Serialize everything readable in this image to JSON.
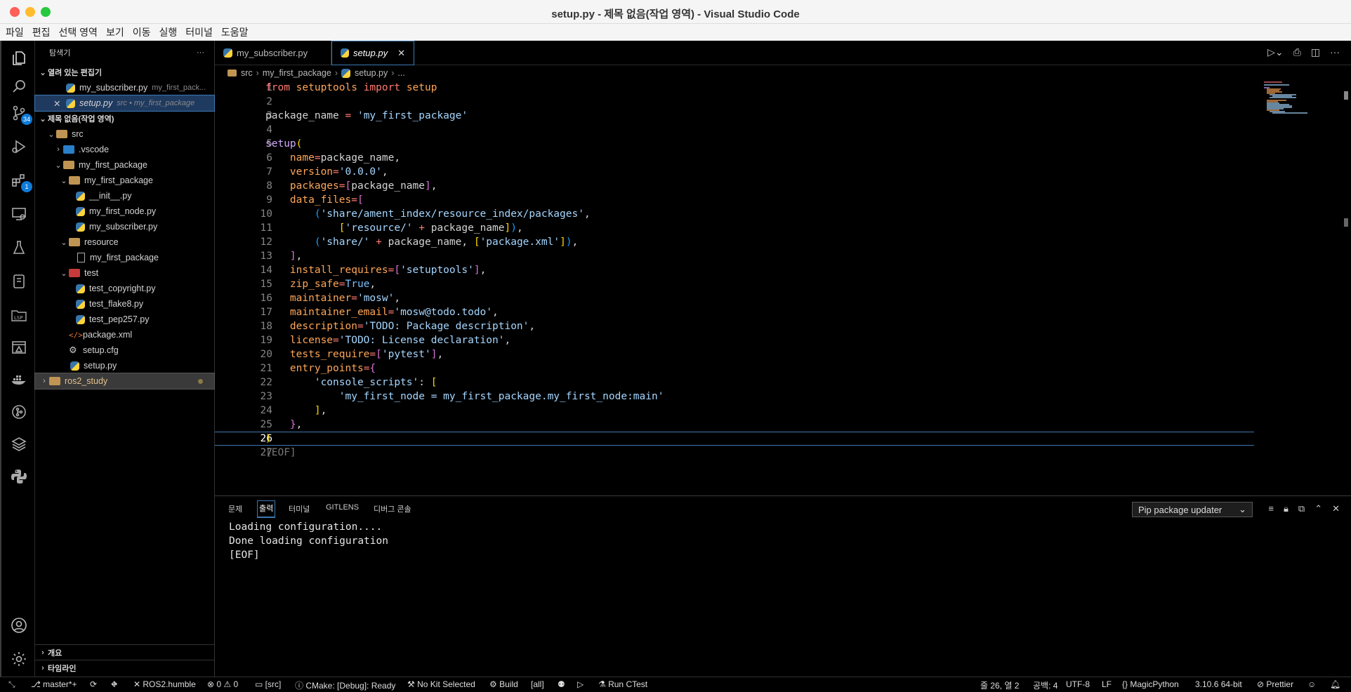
{
  "window": {
    "title": "setup.py - 제목 없음(작업 영역) - Visual Studio Code",
    "traffic_colors": [
      "#fe5f57",
      "#febc2e",
      "#28c840"
    ]
  },
  "menu": [
    "파일",
    "편집",
    "선택 영역",
    "보기",
    "이동",
    "실행",
    "터미널",
    "도움말"
  ],
  "activity": {
    "scm_badge": "34",
    "extensions_badge": "1",
    "lsp_label": "LSP"
  },
  "sidebar": {
    "title": "탐색기",
    "more": "···",
    "open_editors_title": "열려 있는 편집기",
    "open_editors": [
      {
        "name": "my_subscriber.py",
        "desc": "my_first_pack..."
      },
      {
        "name": "setup.py",
        "desc": "src • my_first_package"
      }
    ],
    "workspace_title": "제목 없음(작업 영역)",
    "tree": {
      "src": "src",
      "vscode": ".vscode",
      "pkg": "my_first_package",
      "pkg_inner": "my_first_package",
      "init": "__init__.py",
      "node": "my_first_node.py",
      "sub": "my_subscriber.py",
      "resource": "resource",
      "resource_file": "my_first_package",
      "test": "test",
      "copyright": "test_copyright.py",
      "flake8": "test_flake8.py",
      "pep257": "test_pep257.py",
      "package_xml": "package.xml",
      "setup_cfg": "setup.cfg",
      "setup_py": "setup.py",
      "ros2_study": "ros2_study"
    },
    "outline": "개요",
    "timeline": "타임라인"
  },
  "tabs": [
    {
      "label": "my_subscriber.py"
    },
    {
      "label": "setup.py",
      "close": "✕"
    }
  ],
  "breadcrumb": [
    "src",
    "my_first_package",
    "setup.py",
    "..."
  ],
  "editor": {
    "line_numbers": [
      "1",
      "2",
      "3",
      "4",
      "5",
      "6",
      "7",
      "8",
      "9",
      "10",
      "11",
      "12",
      "13",
      "14",
      "15",
      "16",
      "17",
      "18",
      "19",
      "20",
      "21",
      "22",
      "23",
      "24",
      "25",
      "26",
      "27"
    ],
    "eof": "[EOF]"
  },
  "panel": {
    "tabs": [
      "문제",
      "출력",
      "터미널",
      "GITLENS",
      "디버그 콘솔"
    ],
    "channel": "Pip package updater",
    "output": [
      "Loading configuration....",
      "Done loading configuration",
      "[EOF]"
    ]
  },
  "statusbar": {
    "branch": "master*+",
    "ros": "ROS2.humble",
    "errors": "0",
    "warnings": "0",
    "folder": "[src]",
    "cmake": "CMake: [Debug]: Ready",
    "kit": "No Kit Selected",
    "build": "Build",
    "all": "[all]",
    "ctest": "Run CTest",
    "position": "줄 26, 열 2",
    "spaces": "공백: 4",
    "encoding": "UTF-8",
    "eol": "LF",
    "language": "MagicPython",
    "python": "3.10.6 64-bit",
    "prettier": "Prettier"
  }
}
